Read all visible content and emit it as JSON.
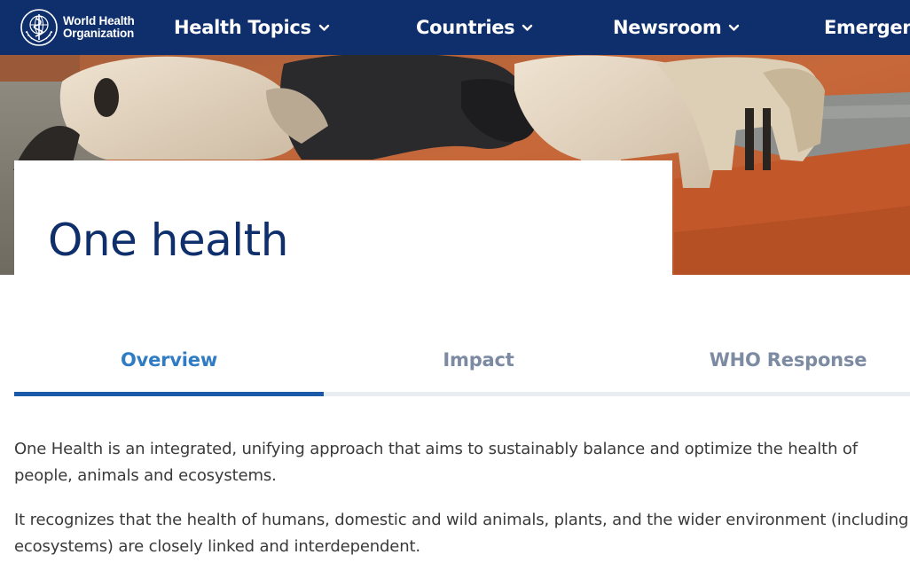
{
  "brand": {
    "line1": "World Health",
    "line2": "Organization",
    "color": "#0e2f6b"
  },
  "nav": {
    "items": [
      {
        "label": "Health Topics",
        "icon": "chevron-down-icon"
      },
      {
        "label": "Countries",
        "icon": "chevron-down-icon"
      },
      {
        "label": "Newsroom",
        "icon": "chevron-down-icon"
      },
      {
        "label": "Emergen"
      }
    ]
  },
  "hero": {
    "image": "cattle-at-waterhole-photo"
  },
  "page": {
    "title": "One health"
  },
  "tabs": {
    "items": [
      {
        "label": "Overview",
        "active": true
      },
      {
        "label": "Impact",
        "active": false
      },
      {
        "label": "WHO Response",
        "active": false
      }
    ],
    "accent": "#1a5aa8",
    "active_text_color": "#2f7bc4"
  },
  "content": {
    "paragraphs": [
      "One Health is an integrated, unifying approach that aims to sustainably balance and optimize the health of people, animals and ecosystems.",
      "It recognizes that the health of humans, domestic and wild animals, plants, and the wider environment (including ecosystems) are closely linked and interdependent."
    ]
  }
}
